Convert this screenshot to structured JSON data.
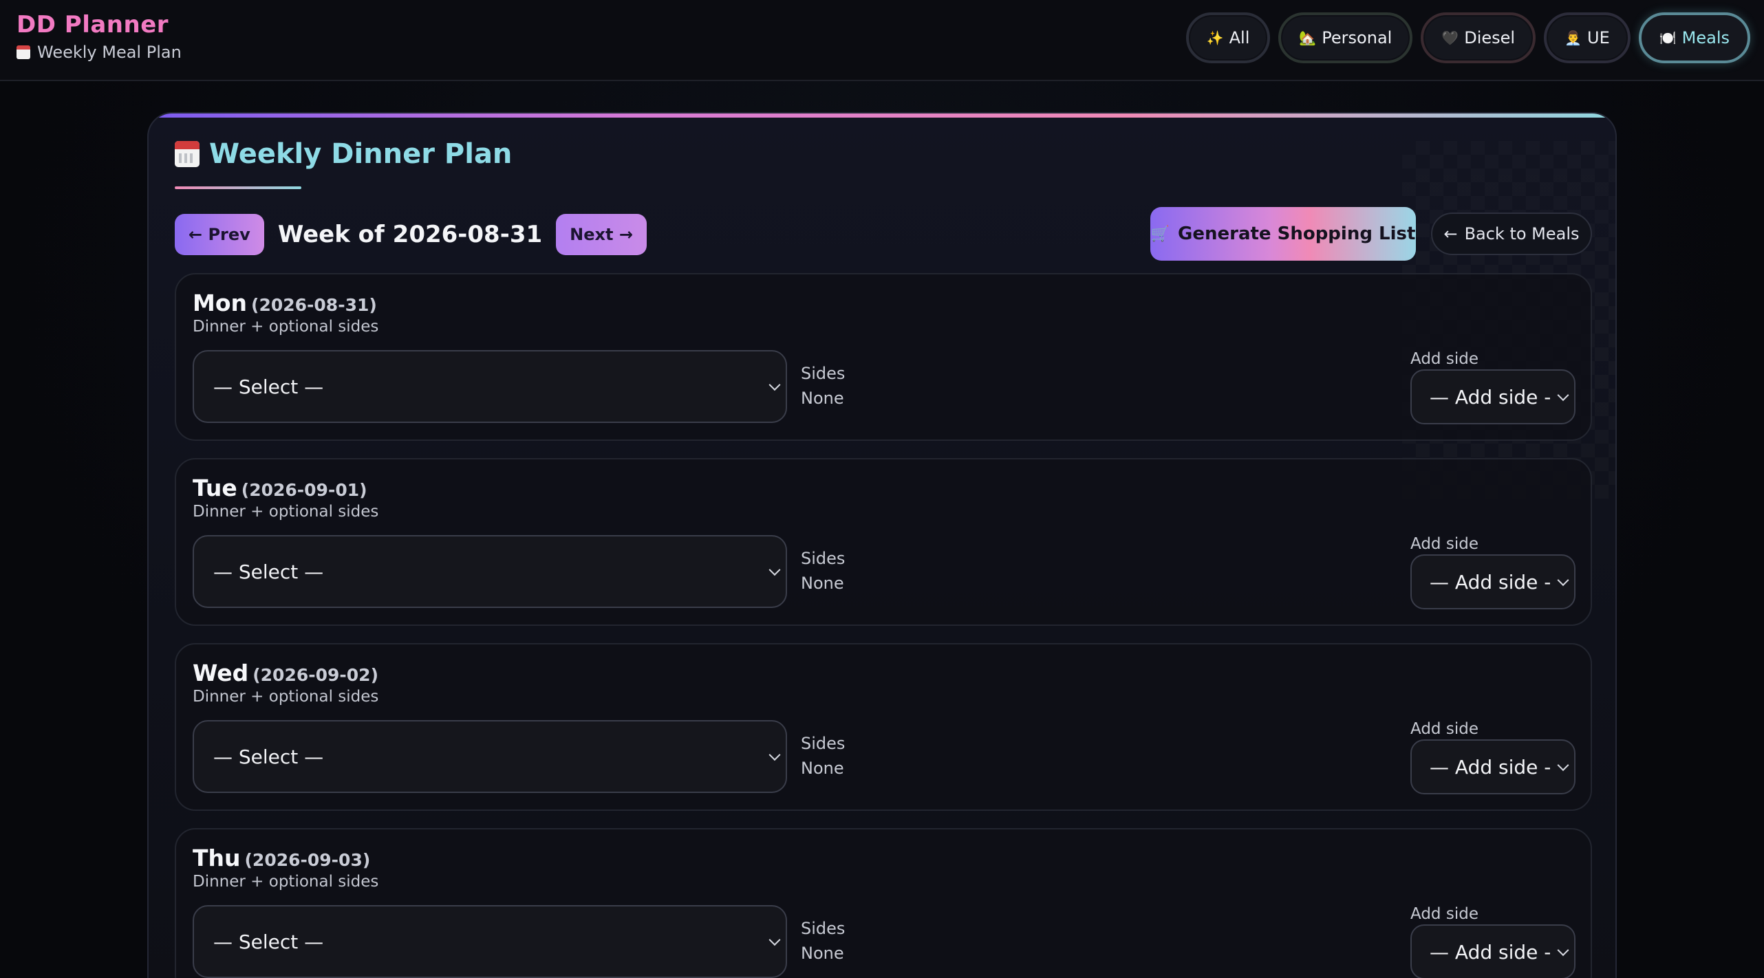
{
  "app": {
    "title": "DD Planner",
    "subtitle": "Weekly Meal Plan"
  },
  "nav": [
    {
      "icon": "✨",
      "label": "All"
    },
    {
      "icon": "🏡",
      "label": "Personal"
    },
    {
      "icon": "🖤",
      "label": "Diesel"
    },
    {
      "icon": "👨‍💼",
      "label": "UE"
    },
    {
      "icon": "🍽️",
      "label": "Meals",
      "active": true
    }
  ],
  "panel": {
    "title": "Weekly Dinner Plan",
    "prev_label": "← Prev",
    "next_label": "Next →",
    "week_label": "Week of 2026-08-31",
    "generate_label": "Generate Shopping List",
    "back_label": "Back to Meals"
  },
  "days": [
    {
      "name": "Mon",
      "date": "(2026-08-31)",
      "subtitle": "Dinner + optional sides",
      "select_value": "— Select —",
      "sides_label": "Sides",
      "sides_value": "None",
      "add_side_label": "Add side",
      "add_side_value": "— Add side -"
    },
    {
      "name": "Tue",
      "date": "(2026-09-01)",
      "subtitle": "Dinner + optional sides",
      "select_value": "— Select —",
      "sides_label": "Sides",
      "sides_value": "None",
      "add_side_label": "Add side",
      "add_side_value": "— Add side -"
    },
    {
      "name": "Wed",
      "date": "(2026-09-02)",
      "subtitle": "Dinner + optional sides",
      "select_value": "— Select —",
      "sides_label": "Sides",
      "sides_value": "None",
      "add_side_label": "Add side",
      "add_side_value": "— Add side -"
    },
    {
      "name": "Thu",
      "date": "(2026-09-03)",
      "subtitle": "Dinner + optional sides",
      "select_value": "— Select —",
      "sides_label": "Sides",
      "sides_value": "None",
      "add_side_label": "Add side",
      "add_side_value": "— Add side -"
    }
  ],
  "colors": {
    "brand": "#f27ac2",
    "title": "#8edbe6",
    "accent_start": "#8a6af0",
    "accent_end": "#9ad6e6"
  }
}
